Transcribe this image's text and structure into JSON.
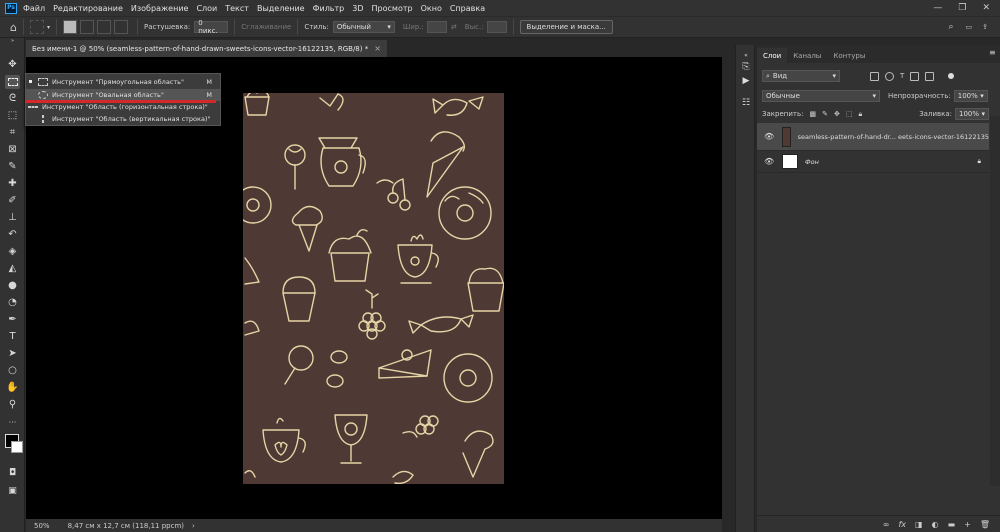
{
  "app": {
    "logo": "Ps"
  },
  "menu": [
    "Файл",
    "Редактирование",
    "Изображение",
    "Слои",
    "Текст",
    "Выделение",
    "Фильтр",
    "3D",
    "Просмотр",
    "Окно",
    "Справка"
  ],
  "window_controls": [
    "—",
    "❐",
    "✕"
  ],
  "options": {
    "feather_label": "Растушевка:",
    "feather_value": "0 пикс.",
    "antialias_label": "Сглаживание",
    "style_label": "Стиль:",
    "style_value": "Обычный",
    "width_label": "Шир.:",
    "height_label": "Выс.:",
    "mask_button": "Выделение и маска..."
  },
  "document_tab": {
    "title": "Без имени-1 @ 50% (seamless-pattern-of-hand-drawn-sweets-icons-vector-16122135, RGB/8) *",
    "close": "×"
  },
  "flyout": [
    {
      "label": "Инструмент \"Прямоугольная область\"",
      "key": "M"
    },
    {
      "label": "Инструмент \"Овальная область\"",
      "key": "M"
    },
    {
      "label": "Инструмент \"Область (горизонтальная строка)\"",
      "key": ""
    },
    {
      "label": "Инструмент \"Область (вертикальная строка)\"",
      "key": ""
    }
  ],
  "status": {
    "zoom": "50%",
    "doc_size": "8,47 см x 12,7 см (118,11 ppcm)",
    "arrow": "›"
  },
  "panel": {
    "tabs": [
      "Слои",
      "Каналы",
      "Контуры"
    ],
    "filter_label": "Вид",
    "blend_mode": "Обычные",
    "opacity_label": "Непрозрачность:",
    "opacity_value": "100%",
    "lock_label": "Закрепить:",
    "fill_label": "Заливка:",
    "fill_value": "100%",
    "layers": [
      {
        "name": "seamless-pattern-of-hand-dr... eets-icons-vector-16122135",
        "selected": true
      },
      {
        "name": "Фон",
        "selected": false
      }
    ],
    "footer_icons": [
      "∞",
      "fx",
      "◨",
      "◐",
      "▬",
      "+",
      "🗑"
    ]
  },
  "colors": {
    "accent": "#31a8ff",
    "canvas_bg": "#000000",
    "doc_bg": "#4e3934",
    "doodle": "#e7d4a6",
    "highlight": "#d22a2a"
  }
}
